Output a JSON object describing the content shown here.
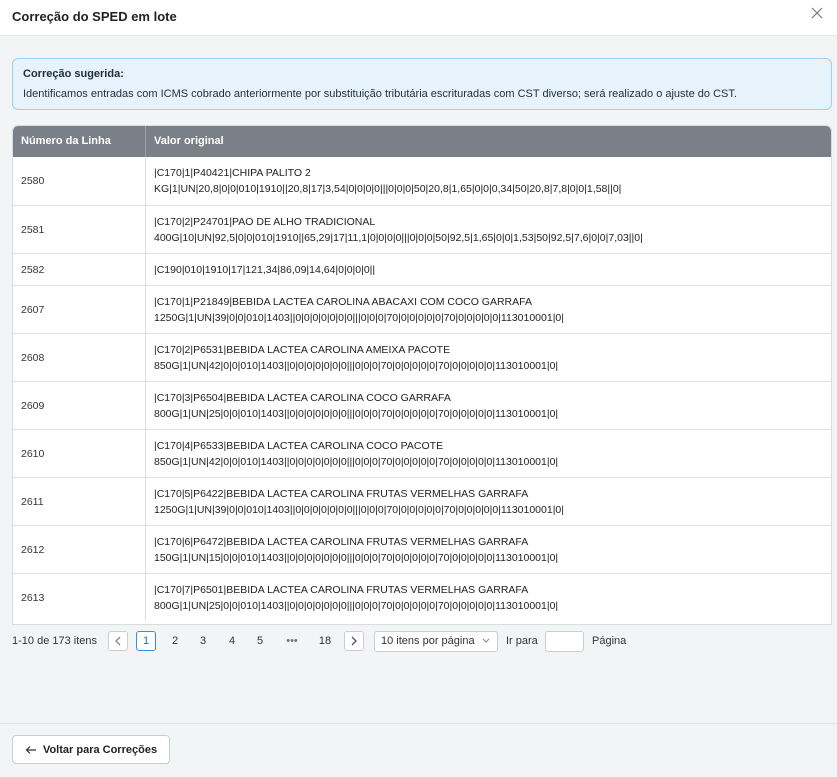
{
  "modal": {
    "title": "Correção do SPED em lote"
  },
  "alert": {
    "title": "Correção sugerida:",
    "text": "Identificamos entradas com ICMS cobrado anteriormente por substituição tributária escrituradas com CST diverso; será realizado o ajuste do CST."
  },
  "table": {
    "headers": {
      "line_number": "Número da Linha",
      "original_value": "Valor original"
    },
    "rows": [
      {
        "line": "2580",
        "value1": "|C170|1|P40421|CHIPA PALITO 2",
        "value2": "KG|1|UN|20,8|0|0|010|1910||20,8|17|3,54|0|0|0|0|||0|0|0|50|20,8|1,65|0|0|0,34|50|20,8|7,8|0|0|1,58||0|"
      },
      {
        "line": "2581",
        "value1": "|C170|2|P24701|PAO DE ALHO TRADICIONAL",
        "value2": "400G|10|UN|92,5|0|0|010|1910||65,29|17|11,1|0|0|0|0|||0|0|0|50|92,5|1,65|0|0|1,53|50|92,5|7,6|0|0|7,03||0|"
      },
      {
        "line": "2582",
        "value1": "|C190|010|1910|17|121,34|86,09|14,64|0|0|0|0||",
        "value2": ""
      },
      {
        "line": "2607",
        "value1": "|C170|1|P21849|BEBIDA LACTEA CAROLINA ABACAXI COM COCO GARRAFA",
        "value2": "1250G|1|UN|39|0|0|010|1403||0|0|0|0|0|0|0|||0|0|0|70|0|0|0|0|0|70|0|0|0|0|0|113010001|0|"
      },
      {
        "line": "2608",
        "value1": "|C170|2|P6531|BEBIDA LACTEA CAROLINA AMEIXA PACOTE",
        "value2": "850G|1|UN|42|0|0|010|1403||0|0|0|0|0|0|0|||0|0|0|70|0|0|0|0|0|70|0|0|0|0|0|113010001|0|"
      },
      {
        "line": "2609",
        "value1": "|C170|3|P6504|BEBIDA LACTEA CAROLINA COCO GARRAFA",
        "value2": "800G|1|UN|25|0|0|010|1403||0|0|0|0|0|0|0|||0|0|0|70|0|0|0|0|0|70|0|0|0|0|0|113010001|0|"
      },
      {
        "line": "2610",
        "value1": "|C170|4|P6533|BEBIDA LACTEA CAROLINA COCO PACOTE",
        "value2": "850G|1|UN|42|0|0|010|1403||0|0|0|0|0|0|0|||0|0|0|70|0|0|0|0|0|70|0|0|0|0|0|113010001|0|"
      },
      {
        "line": "2611",
        "value1": "|C170|5|P6422|BEBIDA LACTEA CAROLINA FRUTAS VERMELHAS GARRAFA",
        "value2": "1250G|1|UN|39|0|0|010|1403||0|0|0|0|0|0|0|||0|0|0|70|0|0|0|0|0|70|0|0|0|0|0|113010001|0|"
      },
      {
        "line": "2612",
        "value1": "|C170|6|P6472|BEBIDA LACTEA CAROLINA FRUTAS VERMELHAS GARRAFA",
        "value2": "150G|1|UN|15|0|0|010|1403||0|0|0|0|0|0|0|||0|0|0|70|0|0|0|0|0|70|0|0|0|0|0|113010001|0|"
      },
      {
        "line": "2613",
        "value1": "|C170|7|P6501|BEBIDA LACTEA CAROLINA FRUTAS VERMELHAS GARRAFA",
        "value2": "800G|1|UN|25|0|0|010|1403||0|0|0|0|0|0|0|||0|0|0|70|0|0|0|0|0|70|0|0|0|0|0|113010001|0|"
      }
    ]
  },
  "pagination": {
    "total": "1-10 de 173 itens",
    "prev_icon": "chevron-left-icon",
    "pages": [
      "1",
      "2",
      "3",
      "4",
      "5"
    ],
    "active_page": "1",
    "ellipsis": "•••",
    "last_page": "18",
    "next_icon": "chevron-right-icon",
    "page_size": "10 itens por página",
    "goto_label": "Ir para",
    "goto_value": "",
    "goto_suffix": "Página"
  },
  "footer": {
    "back_label": "Voltar para Correções"
  },
  "colors": {
    "header_bg": "#7a8087",
    "alert_bg": "#e6f3fd",
    "alert_border": "#9ed0f5",
    "accent": "#3b8fd4"
  }
}
